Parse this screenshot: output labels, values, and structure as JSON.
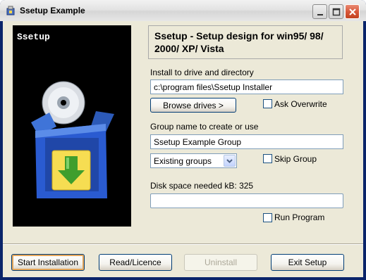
{
  "window": {
    "title": "Ssetup Example",
    "icon": "installer-app-icon"
  },
  "titlebar_buttons": [
    "minimize-icon",
    "maximize-icon",
    "close-icon"
  ],
  "side_panel": {
    "title": "Ssetup",
    "illustration": "software-box-with-cd-icon"
  },
  "header": {
    "text": "Ssetup - Setup design for win95/ 98/ 2000/ XP/ Vista"
  },
  "install_dir": {
    "label": "Install to drive and directory",
    "value": "c:\\program files\\Ssetup Installer",
    "browse_label": "Browse drives >",
    "ask_overwrite_label": "Ask Overwrite",
    "ask_overwrite_checked": false
  },
  "group": {
    "label": "Group name to create or use",
    "value": "Ssetup Example Group",
    "combo_value": "Existing groups",
    "skip_group_label": "Skip Group",
    "skip_group_checked": false
  },
  "disk": {
    "label": "Disk space needed kB: 325",
    "progress": 0,
    "run_program_label": "Run Program",
    "run_program_checked": false
  },
  "footer": {
    "start_label": "Start Installation",
    "read_label": "Read/Licence",
    "uninstall_label": "Uninstall",
    "exit_label": "Exit Setup"
  },
  "colors": {
    "titlebar": "#e3e3e3",
    "client": "#ece9d8",
    "side_panel": "#000000",
    "box_blue": "#2a5bd1",
    "arrow_green": "#3f9e2d"
  }
}
